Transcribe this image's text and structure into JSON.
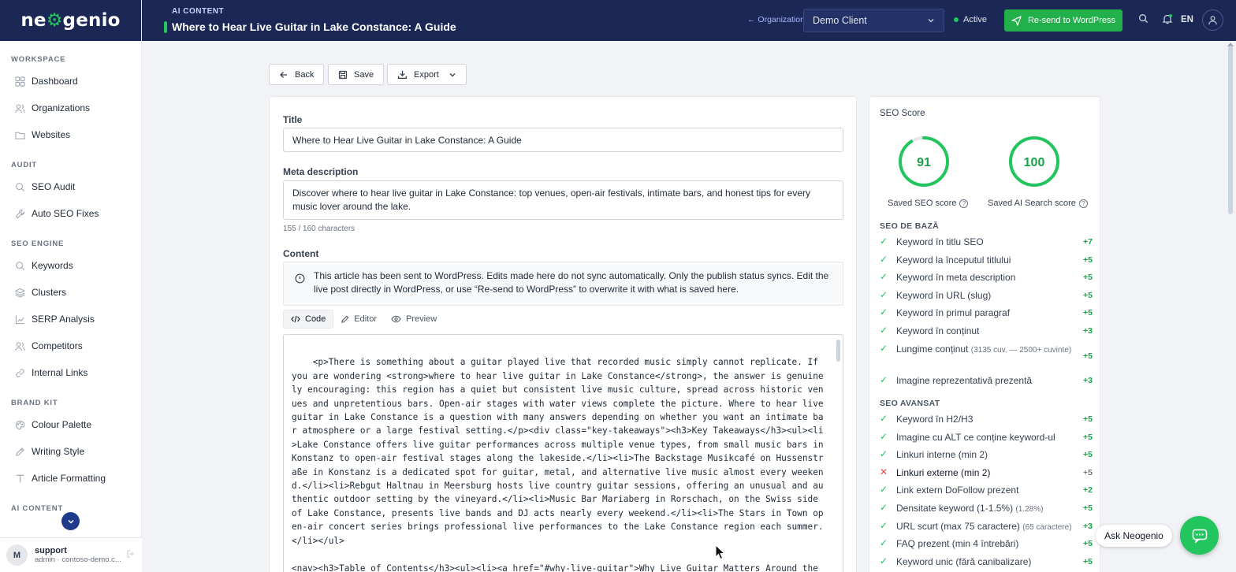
{
  "brand": {
    "logo_text_left": "ne",
    "logo_text_right": "genio",
    "accent": "#22c55e",
    "nav_bg": "#1b2856"
  },
  "sidebar": {
    "sections": [
      {
        "label": "WORKSPACE",
        "items": [
          {
            "label": "Dashboard",
            "icon": "grid-icon"
          },
          {
            "label": "Organizations",
            "icon": "users-icon"
          },
          {
            "label": "Websites",
            "icon": "folder-icon"
          }
        ]
      },
      {
        "label": "AUDIT",
        "items": [
          {
            "label": "SEO Audit",
            "icon": "search-icon"
          },
          {
            "label": "Auto SEO Fixes",
            "icon": "wrench-icon"
          }
        ]
      },
      {
        "label": "SEO ENGINE",
        "items": [
          {
            "label": "Keywords",
            "icon": "search-icon"
          },
          {
            "label": "Clusters",
            "icon": "layers-icon"
          },
          {
            "label": "SERP Analysis",
            "icon": "chart-icon"
          },
          {
            "label": "Competitors",
            "icon": "users-icon"
          },
          {
            "label": "Internal Links",
            "icon": "link-icon"
          }
        ]
      },
      {
        "label": "BRAND KIT",
        "items": [
          {
            "label": "Colour Palette",
            "icon": "palette-icon"
          },
          {
            "label": "Writing Style",
            "icon": "pen-icon"
          },
          {
            "label": "Article Formatting",
            "icon": "text-icon"
          }
        ]
      },
      {
        "label": "AI CONTENT",
        "items": []
      }
    ],
    "user": {
      "initial": "M",
      "name": "support",
      "subtitle": "admin · contoso-demo.c..."
    }
  },
  "topbar": {
    "section_label": "AI CONTENT",
    "page_title": "Where to Hear Live Guitar in Lake Constance: A Guide",
    "org_link": "← Organizations",
    "client": "Demo Client",
    "status": "Active",
    "resend_label": "Re-send to WordPress",
    "lang": "EN"
  },
  "actions": {
    "back": "Back",
    "save": "Save",
    "export": "Export"
  },
  "editor": {
    "title_label": "Title",
    "title_value": "Where to Hear Live Guitar in Lake Constance: A Guide",
    "meta_label": "Meta description",
    "meta_value": "Discover where to hear live guitar in Lake Constance: top venues, open-air festivals, intimate bars, and honest tips for every music lover around the lake.",
    "meta_count": "155 / 160 characters",
    "content_label": "Content",
    "info_text": "This article has been sent to WordPress. Edits made here do not sync automatically. Only the publish status syncs. Edit the live post directly in WordPress, or use “Re-send to WordPress” to overwrite it with what is saved here.",
    "tabs": [
      {
        "label": "Code"
      },
      {
        "label": "Editor"
      },
      {
        "label": "Preview"
      }
    ],
    "code": "<p>There is something about a guitar played live that recorded music simply cannot replicate. If you are wondering <strong>where to hear live guitar in Lake Constance</strong>, the answer is genuinely encouraging: this region has a quiet but consistent live music culture, spread across historic venues and unpretentious bars. Open-air stages with water views complete the picture. Where to hear live guitar in Lake Constance is a question with many answers depending on whether you want an intimate bar atmosphere or a large festival setting.</p><div class=\"key-takeaways\"><h3>Key Takeaways</h3><ul><li>Lake Constance offers live guitar performances across multiple venue types, from small music bars in Konstanz to open-air festival stages along the lakeside.</li><li>The Backstage Musikcafé on Hussenstraße in Konstanz is a dedicated spot for guitar, metal, and alternative live music almost every weekend.</li><li>Rebgut Haltnau in Meersburg hosts live country guitar sessions, offering an unusual and authentic outdoor setting by the vineyard.</li><li>Music Bar Mariaberg in Rorschach, on the Swiss side of Lake Constance, presents live bands and DJ acts nearly every weekend.</li><li>The Stars in Town open-air concert series brings professional live performances to the Lake Constance region each summer.</li></ul>\n\n<nav><h3>Table of Contents</h3><ul><li><a href=\"#why-live-guitar\">Why Live Guitar Matters Around the Lake</a></li><li><a href=\"#backstage-musikcafe\">Backstage Musikcafé: Where to Hear Live Guitar in"
  },
  "seo": {
    "title": "SEO Score",
    "seo_score": 91,
    "ai_score": 100,
    "seo_score_label": "Saved SEO score",
    "ai_score_label": "Saved AI Search score",
    "basic_label": "SEO DE BAZĂ",
    "basic": [
      {
        "text": "Keyword în titlu SEO",
        "pts": "+7",
        "ok": true
      },
      {
        "text": "Keyword la începutul titlului",
        "pts": "+5",
        "ok": true
      },
      {
        "text": "Keyword în meta description",
        "pts": "+5",
        "ok": true
      },
      {
        "text": "Keyword în URL (slug)",
        "pts": "+5",
        "ok": true
      },
      {
        "text": "Keyword în primul paragraf",
        "pts": "+5",
        "ok": true
      },
      {
        "text": "Keyword în conținut",
        "pts": "+3",
        "ok": true
      },
      {
        "text": "Lungime conținut",
        "note": "(3135 cuv. — 2500+ cuvinte)",
        "pts": "+5",
        "ok": true
      },
      {
        "text": "Imagine reprezentativă prezentă",
        "pts": "+3",
        "ok": true
      }
    ],
    "advanced_label": "SEO AVANSAT",
    "advanced": [
      {
        "text": "Keyword în H2/H3",
        "pts": "+5",
        "ok": true
      },
      {
        "text": "Imagine cu ALT ce conține keyword-ul",
        "pts": "+5",
        "ok": true
      },
      {
        "text": "Linkuri interne (min 2)",
        "pts": "+5",
        "ok": true
      },
      {
        "text": "Linkuri externe (min 2)",
        "pts": "+5",
        "ok": false
      },
      {
        "text": "Link extern DoFollow prezent",
        "pts": "+2",
        "ok": true
      },
      {
        "text": "Densitate keyword (1-1.5%)",
        "note": "(1.28%)",
        "pts": "+5",
        "ok": true
      },
      {
        "text": "URL scurt (max 75 caractere)",
        "note": "(65 caractere)",
        "pts": "+3",
        "ok": true
      },
      {
        "text": "FAQ prezent (min 4 întrebări)",
        "pts": "+5",
        "ok": true
      },
      {
        "text": "Keyword unic (fără canibalizare)",
        "pts": "+5",
        "ok": true
      }
    ]
  },
  "assistant": {
    "label": "Ask Neogenio"
  }
}
